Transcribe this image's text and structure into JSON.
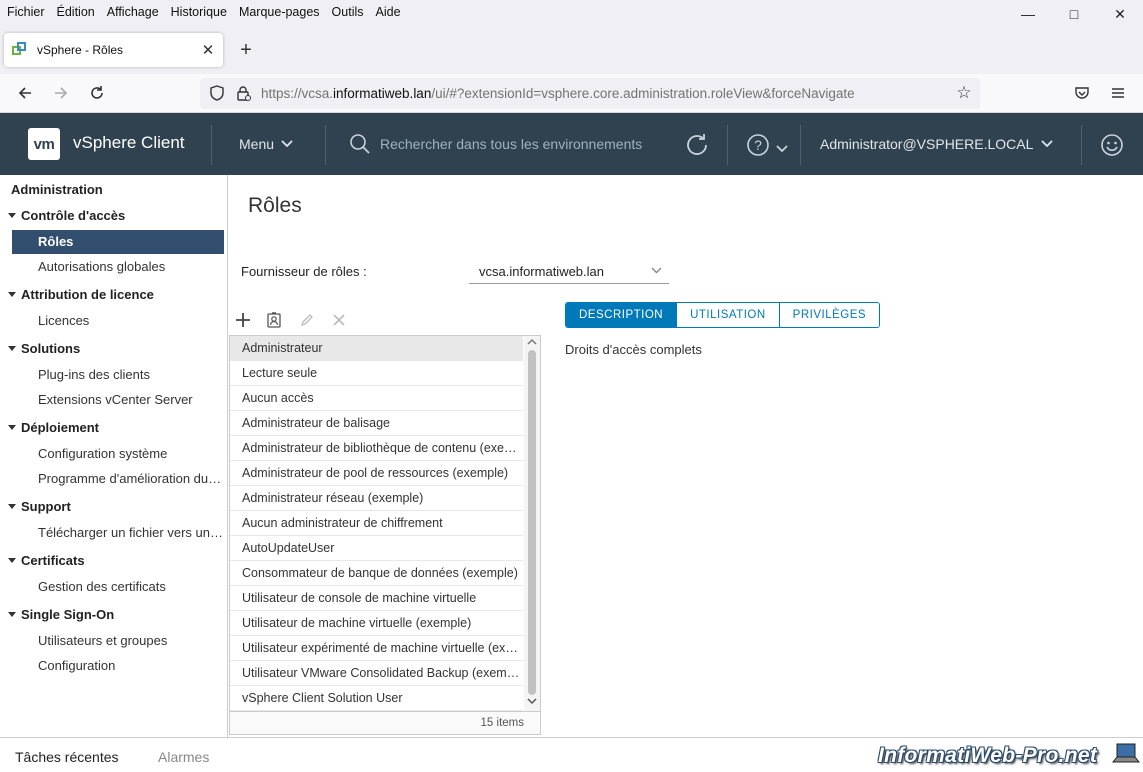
{
  "browser": {
    "menu": [
      "Fichier",
      "Édition",
      "Affichage",
      "Historique",
      "Marque-pages",
      "Outils",
      "Aide"
    ],
    "tab_title": "vSphere - Rôles",
    "url_prefix": "https://vcsa.",
    "url_domain": "informatiweb.lan",
    "url_path": "/ui/#?extensionId=vsphere.core.administration.roleView&forceNavigate"
  },
  "header": {
    "logo": "vm",
    "app_name": "vSphere Client",
    "menu_label": "Menu",
    "search_placeholder": "Rechercher dans tous les environnements",
    "user": "Administrator@VSPHERE.LOCAL"
  },
  "sidebar": {
    "root": "Administration",
    "groups": [
      {
        "label": "Contrôle d'accès",
        "items": [
          "Rôles",
          "Autorisations globales"
        ]
      },
      {
        "label": "Attribution de licence",
        "items": [
          "Licences"
        ]
      },
      {
        "label": "Solutions",
        "items": [
          "Plug-ins des clients",
          "Extensions vCenter Server"
        ]
      },
      {
        "label": "Déploiement",
        "items": [
          "Configuration système",
          "Programme d'amélioration du produit"
        ]
      },
      {
        "label": "Support",
        "items": [
          "Télécharger un fichier vers une demande de service"
        ]
      },
      {
        "label": "Certificats",
        "items": [
          "Gestion des certificats"
        ]
      },
      {
        "label": "Single Sign-On",
        "items": [
          "Utilisateurs et groupes",
          "Configuration"
        ]
      }
    ]
  },
  "main": {
    "title": "Rôles",
    "provider_label": "Fournisseur de rôles :",
    "provider_value": "vcsa.informatiweb.lan",
    "roles": [
      "Administrateur",
      "Lecture seule",
      "Aucun accès",
      "Administrateur de balisage",
      "Administrateur de bibliothèque de contenu (exemple)",
      "Administrateur de pool de ressources (exemple)",
      "Administrateur réseau (exemple)",
      "Aucun administrateur de chiffrement",
      "AutoUpdateUser",
      "Consommateur de banque de données (exemple)",
      "Utilisateur de console de machine virtuelle",
      "Utilisateur de machine virtuelle (exemple)",
      "Utilisateur expérimenté de machine virtuelle (exemple)",
      "Utilisateur VMware Consolidated Backup (exemple)",
      "vSphere Client Solution User"
    ],
    "items_count": "15 items",
    "detail_tabs": [
      "DESCRIPTION",
      "UTILISATION",
      "PRIVILÈGES"
    ],
    "description": "Droits d'accès complets"
  },
  "bottom": {
    "recent_tasks": "Tâches récentes",
    "alarms": "Alarmes",
    "watermark": "InformatiWeb-Pro.net"
  },
  "colors": {
    "header_bg": "#304250",
    "nav_active": "#324f70",
    "accent": "#0079b8"
  }
}
